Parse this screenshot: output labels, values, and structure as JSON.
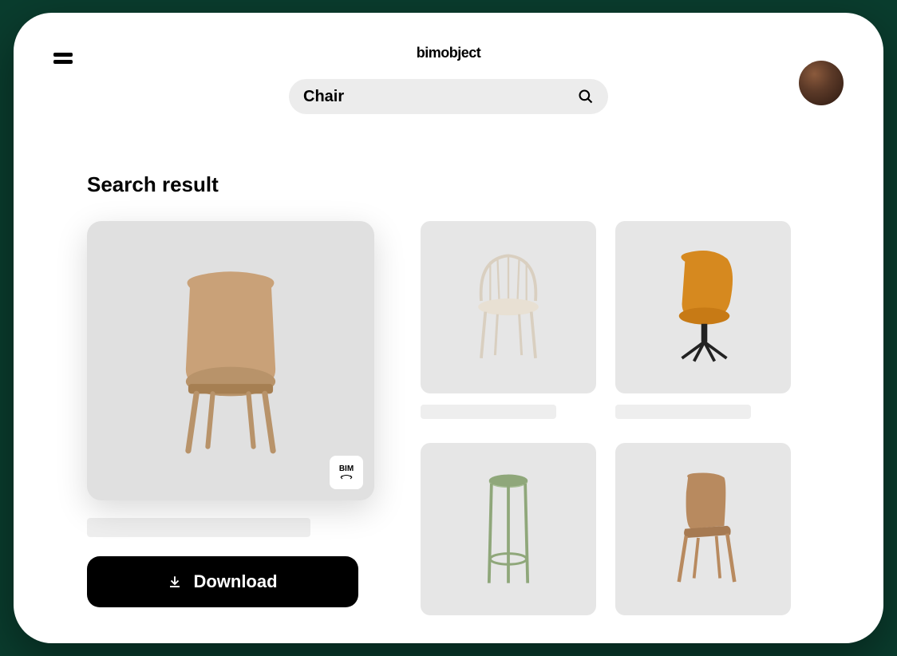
{
  "header": {
    "logo": "bimobject",
    "search_value": "Chair"
  },
  "section_title": "Search result",
  "featured": {
    "bim_badge": "BIM",
    "download_label": "Download"
  },
  "products": [
    {
      "type": "upholstered-dining-chair",
      "color": "#c9a178"
    },
    {
      "type": "windsor-chair",
      "color": "#d9cfc0"
    },
    {
      "type": "swivel-lounge-chair",
      "color": "#d6891f"
    },
    {
      "type": "bar-stool",
      "color": "#8fa77a"
    },
    {
      "type": "molded-wood-chair",
      "color": "#b88a5f"
    }
  ]
}
